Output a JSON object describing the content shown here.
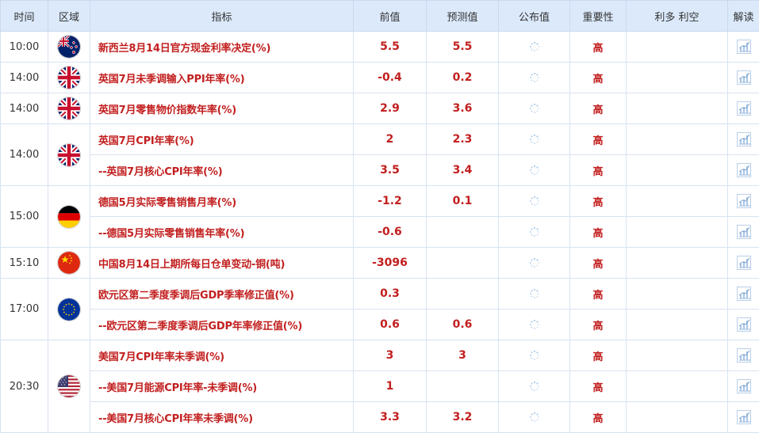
{
  "headers": {
    "time": "时间",
    "region": "区域",
    "indicator": "指标",
    "previous": "前值",
    "forecast": "预测值",
    "actual": "公布值",
    "importance": "重要性",
    "impact": "利多 利空",
    "analysis": "解读"
  },
  "colors": {
    "header_bg": "#dbe9fb",
    "indicator_text": "#c21f1f",
    "border": "#d7e3f2"
  },
  "groups": [
    {
      "time": "10:00",
      "flag": "new-zealand-flag-icon",
      "rows": [
        {
          "indicator": "新西兰8月14日官方现金利率决定(%)",
          "previous": "5.5",
          "forecast": "5.5",
          "importance": "高"
        }
      ]
    },
    {
      "time": "14:00",
      "flag": "uk-flag-icon",
      "rows": [
        {
          "indicator": "英国7月未季调输入PPI年率(%)",
          "previous": "-0.4",
          "forecast": "0.2",
          "importance": "高"
        }
      ]
    },
    {
      "time": "14:00",
      "flag": "uk-flag-icon",
      "rows": [
        {
          "indicator": "英国7月零售物价指数年率(%)",
          "previous": "2.9",
          "forecast": "3.6",
          "importance": "高"
        }
      ]
    },
    {
      "time": "14:00",
      "flag": "uk-flag-icon",
      "rows": [
        {
          "indicator": "英国7月CPI年率(%)",
          "previous": "2",
          "forecast": "2.3",
          "importance": "高"
        },
        {
          "indicator": "--英国7月核心CPI年率(%)",
          "previous": "3.5",
          "forecast": "3.4",
          "importance": "高"
        }
      ]
    },
    {
      "time": "15:00",
      "flag": "germany-flag-icon",
      "rows": [
        {
          "indicator": "德国5月实际零售销售月率(%)",
          "previous": "-1.2",
          "forecast": "0.1",
          "importance": "高"
        },
        {
          "indicator": "--德国5月实际零售销售年率(%)",
          "previous": "-0.6",
          "forecast": "",
          "importance": "高"
        }
      ]
    },
    {
      "time": "15:10",
      "flag": "china-flag-icon",
      "rows": [
        {
          "indicator": "中国8月14日上期所每日仓单变动-铜(吨)",
          "previous": "-3096",
          "forecast": "",
          "importance": "高"
        }
      ]
    },
    {
      "time": "17:00",
      "flag": "eu-flag-icon",
      "rows": [
        {
          "indicator": "欧元区第二季度季调后GDP季率修正值(%)",
          "previous": "0.3",
          "forecast": "",
          "importance": "高"
        },
        {
          "indicator": "--欧元区第二季度季调后GDP年率修正值(%)",
          "previous": "0.6",
          "forecast": "0.6",
          "importance": "高"
        }
      ]
    },
    {
      "time": "20:30",
      "flag": "usa-flag-icon",
      "rows": [
        {
          "indicator": "美国7月CPI年率未季调(%)",
          "previous": "3",
          "forecast": "3",
          "importance": "高"
        },
        {
          "indicator": "--美国7月能源CPI年率-未季调(%)",
          "previous": "1",
          "forecast": "",
          "importance": "高"
        },
        {
          "indicator": "--美国7月核心CPI年率未季调(%)",
          "previous": "3.3",
          "forecast": "3.2",
          "importance": "高"
        }
      ]
    }
  ]
}
